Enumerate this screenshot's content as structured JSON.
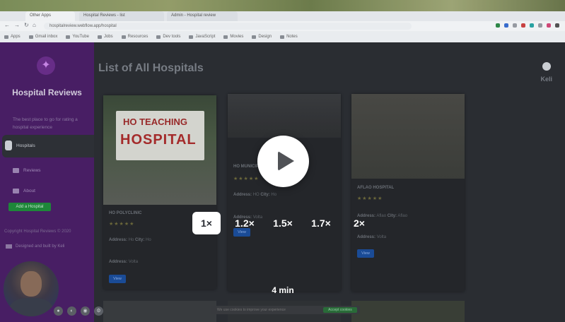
{
  "browser": {
    "tabs": [
      "Other Apps",
      "Hospital Reviews - list",
      "Admin - Hospital review"
    ],
    "url": "hospitalreview.webflow.app/hospital",
    "bookmarks": [
      "Apps",
      "Gmail inbox",
      "YouTube",
      "Jobs",
      "Resources",
      "Dev tools",
      "JavaScript",
      "Movies",
      "Design",
      "Notes"
    ]
  },
  "sidebar": {
    "brand": "Hospital Reviews",
    "tagline": "The best place to go for rating a hospital experience",
    "nav": [
      {
        "label": "Hospitals",
        "icon": "hospital-icon",
        "active": true
      },
      {
        "label": "Reviews",
        "icon": "book-icon"
      },
      {
        "label": "About",
        "icon": "user-icon"
      }
    ],
    "add_button": "Add a Hospital",
    "copyright": "Copyright Hospital Reviews © 2020",
    "developer": "Designed and built by Keli"
  },
  "main": {
    "heading": "List of All Hospitals",
    "user_name": "Keli",
    "cards": [
      {
        "name": "HO POLYCLINIC",
        "stars": "★★★★★",
        "address_label": "Address:",
        "address": "Ho",
        "city_label": "City:",
        "city": "Ho",
        "region_label": "Address:",
        "region": "Volta",
        "button": "View",
        "sign_line1": "HO TEACHING",
        "sign_line2": "HOSPITAL"
      },
      {
        "name": "HO MUNICIPAL HOSPITAL",
        "stars": "★★★★★",
        "address_label": "Address:",
        "address": "HO",
        "city_label": "City:",
        "city": "Ho",
        "region_label": "Address:",
        "region": "Volta",
        "button": "View"
      },
      {
        "name": "AFLAO HOSPITAL",
        "stars": "★★★★★",
        "address_label": "Address:",
        "address": "Aflao",
        "city_label": "City:",
        "city": "Aflao",
        "region_label": "Address:",
        "region": "Volta",
        "button": "View"
      }
    ],
    "cookie_text": "We use cookies to improve your experience",
    "cookie_button": "Accept cookies"
  },
  "player": {
    "speeds": [
      "1×",
      "1.2×",
      "1.5×",
      "1.7×",
      "2×"
    ],
    "selected_speed": "1×",
    "duration": "4 min"
  },
  "colors": {
    "sidebar_bg": "#4a1f66",
    "add_button": "#1f8a3b",
    "view_button": "#1b4d9a",
    "overlay_text": "#ffffff"
  }
}
